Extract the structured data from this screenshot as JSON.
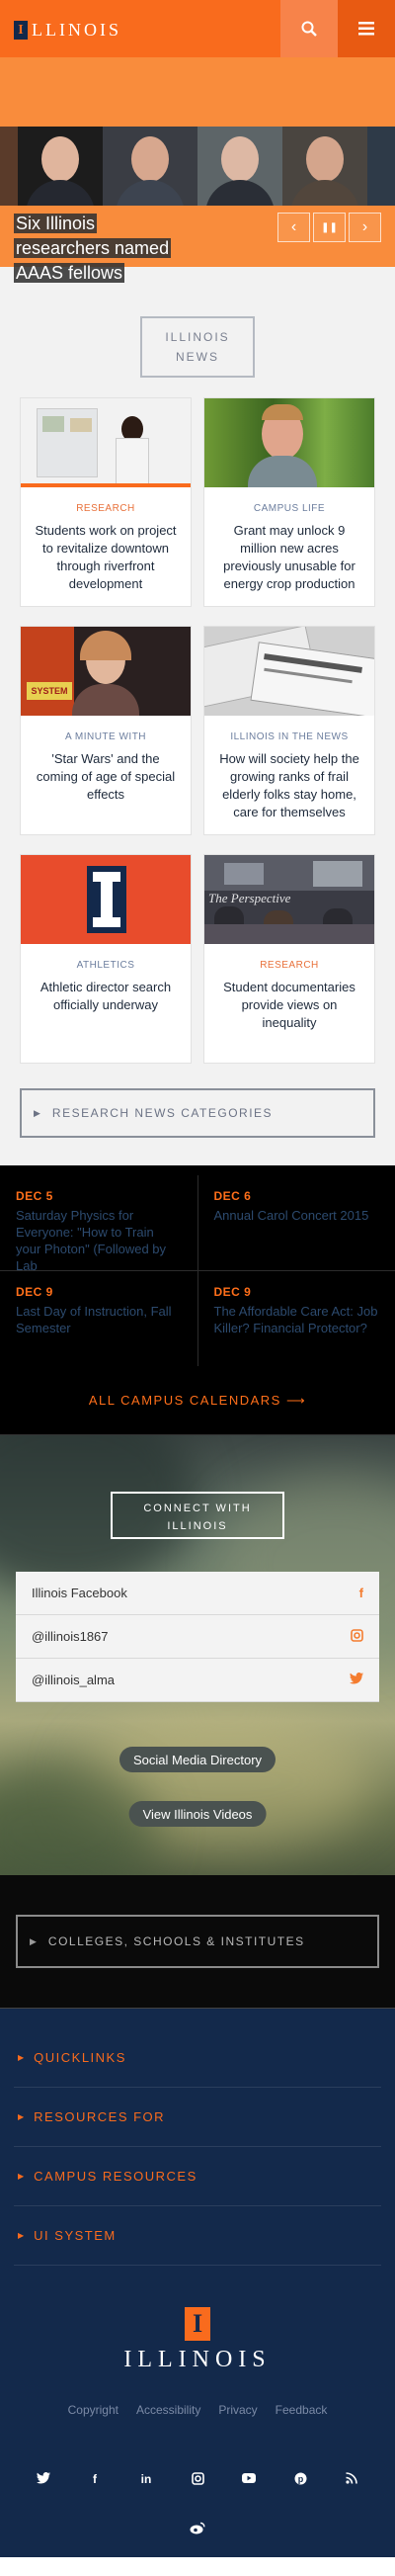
{
  "header": {
    "logo_letter": "I",
    "logo_text": "LLINOIS",
    "search_icon": "search-icon",
    "menu_icon": "menu-icon"
  },
  "hero": {
    "caption": "Six Illinois researchers named AAAS fellows",
    "controls": {
      "prev": "‹",
      "pause": "❚❚",
      "next": "›"
    }
  },
  "news": {
    "title": "ILLINOIS NEWS",
    "items": [
      {
        "category": "RESEARCH",
        "headline": "Students work on project to revitalize downtown through riverfront development"
      },
      {
        "category": "CAMPUS LIFE",
        "headline": "Grant may unlock 9 million new acres previously unusable for energy crop production"
      },
      {
        "category": "A MINUTE WITH",
        "headline": "'Star Wars' and the coming of age of special effects"
      },
      {
        "category": "ILLINOIS IN THE NEWS",
        "headline": "How will society help the growing ranks of frail elderly folks stay home, care for themselves"
      },
      {
        "category": "ATHLETICS",
        "headline": "Athletic director search officially underway"
      },
      {
        "category": "RESEARCH",
        "headline": "Student documentaries provide views on inequality"
      }
    ],
    "categories_button": "RESEARCH NEWS CATEGORIES"
  },
  "events": {
    "items": [
      {
        "date": "DEC 5",
        "title": "Saturday Physics for Everyone: \"How to Train your Photon\" (Followed by Lab"
      },
      {
        "date": "DEC 6",
        "title": "Annual Carol Concert 2015"
      },
      {
        "date": "DEC 9",
        "title": "Last Day of Instruction, Fall Semester"
      },
      {
        "date": "DEC 9",
        "title": "The Affordable Care Act: Job Killer? Financial Protector?"
      }
    ],
    "all_calendars": "ALL CAMPUS CALENDARS ⟶"
  },
  "social": {
    "title": "CONNECT WITH ILLINOIS",
    "items": [
      {
        "label": "Illinois Facebook",
        "icon": "f"
      },
      {
        "label": "@illinois1867",
        "icon": "◙"
      },
      {
        "label": "@illinois_alma",
        "icon": "🐦"
      }
    ],
    "directory": "Social Media Directory",
    "videos": "View Illinois Videos"
  },
  "colleges": {
    "label": "COLLEGES, SCHOOLS & INSTITUTES"
  },
  "footer": {
    "links": [
      "QUICKLINKS",
      "RESOURCES FOR",
      "CAMPUS RESOURCES",
      "UI SYSTEM"
    ],
    "logo_letter": "I",
    "logo_text": "ILLINOIS",
    "legal": [
      "Copyright",
      "Accessibility",
      "Privacy",
      "Feedback"
    ],
    "social_icons": [
      "twitter-icon",
      "facebook-icon",
      "linkedin-icon",
      "instagram-icon",
      "youtube-icon",
      "pinterest-icon",
      "rss-icon"
    ],
    "weibo_icon": "weibo-icon"
  },
  "colors": {
    "orange": "#f96b1d",
    "navy": "#13294b"
  }
}
